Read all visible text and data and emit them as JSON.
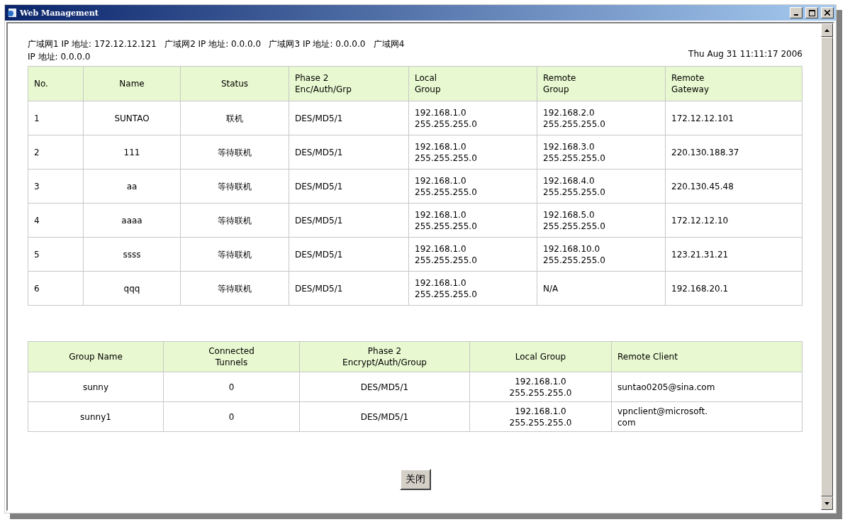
{
  "window": {
    "title": "Web Management"
  },
  "wan_info": "广域网1 IP 地址: 172.12.12.121   广域网2 IP 地址: 0.0.0.0   广域网3 IP 地址: 0.0.0.0   广域网4 IP 地址: 0.0.0.0",
  "datetime": "Thu Aug 31 11:11:17 2006",
  "tunnels": {
    "columns": [
      "No.",
      "Name",
      "Status",
      "Phase 2\nEnc/Auth/Grp",
      "Local\nGroup",
      "Remote\nGroup",
      "Remote\nGateway"
    ],
    "rows": [
      [
        "1",
        "SUNTAO",
        "联机",
        "DES/MD5/1",
        "192.168.1.0\n255.255.255.0",
        "192.168.2.0\n255.255.255.0",
        "172.12.12.101"
      ],
      [
        "2",
        "111",
        "等待联机",
        "DES/MD5/1",
        "192.168.1.0\n255.255.255.0",
        "192.168.3.0\n255.255.255.0",
        "220.130.188.37"
      ],
      [
        "3",
        "aa",
        "等待联机",
        "DES/MD5/1",
        "192.168.1.0\n255.255.255.0",
        "192.168.4.0\n255.255.255.0",
        "220.130.45.48"
      ],
      [
        "4",
        "aaaa",
        "等待联机",
        "DES/MD5/1",
        "192.168.1.0\n255.255.255.0",
        "192.168.5.0\n255.255.255.0",
        "172.12.12.10"
      ],
      [
        "5",
        "ssss",
        "等待联机",
        "DES/MD5/1",
        "192.168.1.0\n255.255.255.0",
        "192.168.10.0\n255.255.255.0",
        "123.21.31.21"
      ],
      [
        "6",
        "qqq",
        "等待联机",
        "DES/MD5/1",
        "192.168.1.0\n255.255.255.0",
        "N/A",
        "192.168.20.1"
      ]
    ]
  },
  "groups": {
    "columns": [
      "Group Name",
      "Connected\nTunnels",
      "Phase 2\nEncrypt/Auth/Group",
      "Local Group",
      "Remote Client"
    ],
    "rows": [
      [
        "sunny",
        "0",
        "DES/MD5/1",
        "192.168.1.0\n255.255.255.0",
        "suntao0205@sina.com"
      ],
      [
        "sunny1",
        "0",
        "DES/MD5/1",
        "192.168.1.0\n255.255.255.0",
        "vpnclient@microsoft.\ncom"
      ]
    ]
  },
  "close_button": "关闭"
}
